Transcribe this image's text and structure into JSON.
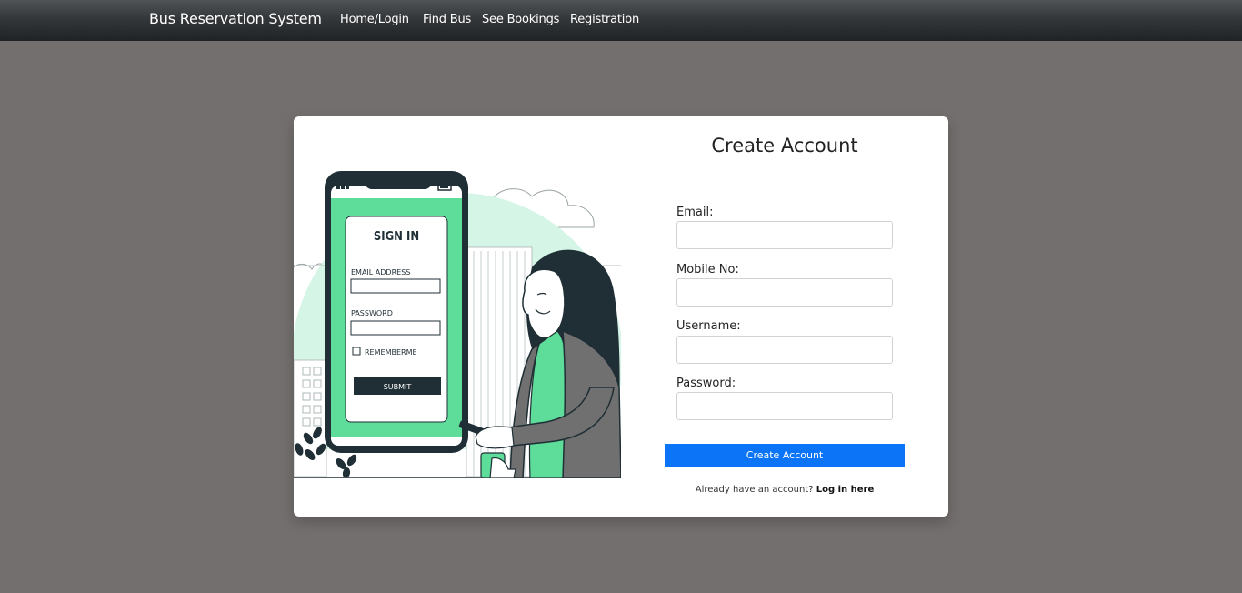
{
  "navbar": {
    "brand": "Bus Reservation System",
    "links": [
      {
        "label": "Home/Login"
      },
      {
        "label": "Find Bus"
      },
      {
        "label": "See Bookings"
      },
      {
        "label": "Registration"
      }
    ]
  },
  "illustration": {
    "title": "SIGN IN",
    "email_label": "EMAIL ADDRESS",
    "password_label": "PASSWORD",
    "remember_label": "REMEMBERME",
    "submit_label": "SUBMIT"
  },
  "form": {
    "title": "Create Account",
    "fields": [
      {
        "label": "Email:",
        "value": ""
      },
      {
        "label": "Mobile No:",
        "value": ""
      },
      {
        "label": "Username:",
        "value": ""
      },
      {
        "label": "Password:",
        "value": ""
      }
    ],
    "submit_label": "Create Account",
    "login_prompt": "Already have an account?",
    "login_link": "Log in here"
  },
  "colors": {
    "background": "#736f6e",
    "navbar": "#2b2e31",
    "accent_blue": "#0b74f7",
    "illustration_green": "#5ddc9a",
    "illustration_dark": "#1f2f35"
  }
}
